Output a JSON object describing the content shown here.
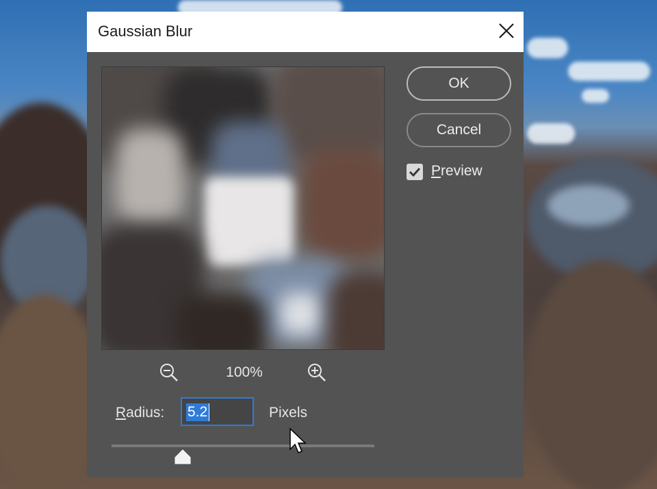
{
  "dialog": {
    "title": "Gaussian Blur",
    "close_icon": "close-icon"
  },
  "buttons": {
    "ok_label": "OK",
    "cancel_label": "Cancel"
  },
  "preview_option": {
    "label_first": "P",
    "label_rest": "review",
    "checked": true
  },
  "zoom": {
    "level": "100%",
    "zoom_out_icon": "zoom-out-icon",
    "zoom_in_icon": "zoom-in-icon"
  },
  "radius": {
    "label_first": "R",
    "label_rest": "adius:",
    "value": "5.2",
    "unit": "Pixels",
    "slider_fraction": 0.27
  },
  "colors": {
    "dialog_bg": "#535353",
    "accent": "#2f7bd8",
    "text": "#e6e6e6"
  }
}
